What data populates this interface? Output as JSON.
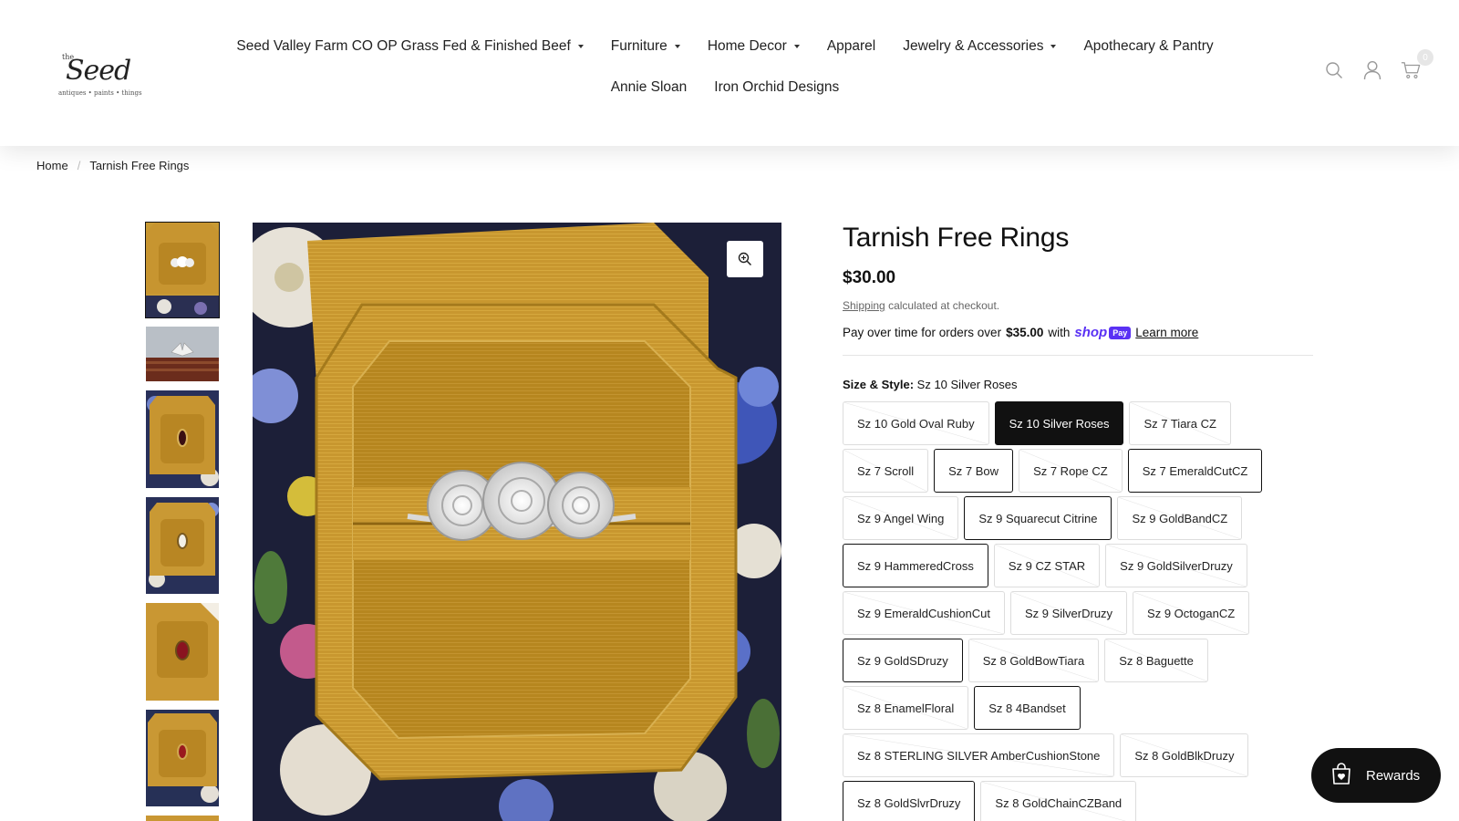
{
  "brand": {
    "small": "the",
    "name": "Seed",
    "tagline": "antiques • paints • things"
  },
  "nav": {
    "items": [
      {
        "label": "Seed Valley Farm CO OP Grass Fed & Finished Beef",
        "dropdown": true
      },
      {
        "label": "Furniture",
        "dropdown": true
      },
      {
        "label": "Home Decor",
        "dropdown": true
      },
      {
        "label": "Apparel",
        "dropdown": false
      },
      {
        "label": "Jewelry & Accessories",
        "dropdown": true
      },
      {
        "label": "Apothecary & Pantry",
        "dropdown": false
      },
      {
        "label": "Annie Sloan",
        "dropdown": false
      },
      {
        "label": "Iron Orchid Designs",
        "dropdown": false
      }
    ]
  },
  "header_icons": {
    "search": "search-icon",
    "account": "account-icon",
    "cart": "cart-icon",
    "cart_count": "0"
  },
  "breadcrumb": {
    "home": "Home",
    "current": "Tarnish Free Rings"
  },
  "product": {
    "title": "Tarnish Free Rings",
    "price": "$30.00",
    "shipping_link": "Shipping",
    "shipping_text": "calculated at checkout.",
    "installments": {
      "prefix": "Pay over time for orders over",
      "amount": "$35.00",
      "with": "with",
      "provider": "shop",
      "provider_badge": "Pay",
      "learn_more": "Learn more"
    },
    "option_label": "Size & Style:",
    "option_value": "Sz 10 Silver Roses",
    "variants": [
      {
        "label": "Sz 10 Gold Oval Ruby",
        "state": "sold"
      },
      {
        "label": "Sz 10 Silver Roses",
        "state": "selected"
      },
      {
        "label": "Sz 7 Tiara CZ",
        "state": "sold"
      },
      {
        "label": "Sz 7 Scroll",
        "state": "sold"
      },
      {
        "label": "Sz 7 Bow",
        "state": "avail"
      },
      {
        "label": "Sz 7 Rope CZ",
        "state": "sold"
      },
      {
        "label": "Sz 7 EmeraldCutCZ",
        "state": "avail"
      },
      {
        "label": "Sz 9 Angel Wing",
        "state": "sold"
      },
      {
        "label": "Sz 9 Squarecut Citrine",
        "state": "avail"
      },
      {
        "label": "Sz 9 GoldBandCZ",
        "state": "sold"
      },
      {
        "label": "Sz 9 HammeredCross",
        "state": "avail"
      },
      {
        "label": "Sz 9 CZ STAR",
        "state": "sold"
      },
      {
        "label": "Sz 9 GoldSilverDruzy",
        "state": "sold"
      },
      {
        "label": "Sz 9 EmeraldCushionCut",
        "state": "sold"
      },
      {
        "label": "Sz 9 SilverDruzy",
        "state": "sold"
      },
      {
        "label": "Sz 9 OctoganCZ",
        "state": "sold"
      },
      {
        "label": "Sz 9 GoldSDruzy",
        "state": "avail"
      },
      {
        "label": "Sz 8 GoldBowTiara",
        "state": "sold"
      },
      {
        "label": "Sz 8 Baguette",
        "state": "sold"
      },
      {
        "label": "Sz 8 EnamelFloral",
        "state": "sold"
      },
      {
        "label": "Sz 8 4Bandset",
        "state": "avail"
      },
      {
        "label": "Sz 8 STERLING SILVER AmberCushionStone",
        "state": "sold"
      },
      {
        "label": "Sz 8 GoldBlkDruzy",
        "state": "sold"
      },
      {
        "label": "Sz 8 GoldSlvrDruzy",
        "state": "avail"
      },
      {
        "label": "Sz 8 GoldChainCZBand",
        "state": "sold"
      }
    ]
  },
  "gallery": {
    "zoom_icon": "zoom-in-icon",
    "thumbnail_count": 7
  },
  "rewards": {
    "label": "Rewards",
    "icon": "shopping-bag-heart-icon"
  },
  "colors": {
    "accent": "#111111",
    "shop_pay": "#5a31f4",
    "gold_velvet": "#c9a03a"
  }
}
